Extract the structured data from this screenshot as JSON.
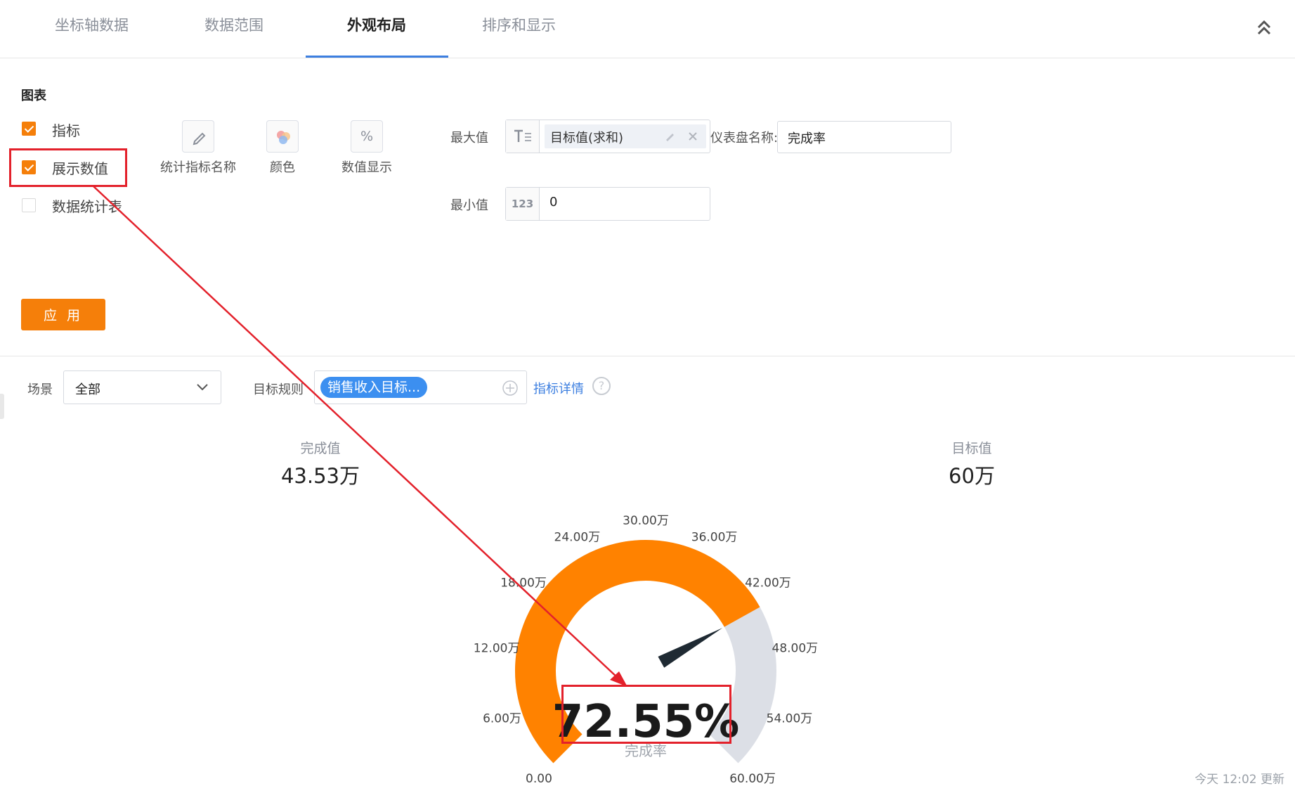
{
  "tabs": [
    {
      "label": "坐标轴数据"
    },
    {
      "label": "数据范围"
    },
    {
      "label": "外观布局"
    },
    {
      "label": "排序和显示"
    }
  ],
  "section_title": "图表",
  "checkboxes": [
    {
      "label": "指标",
      "checked": true
    },
    {
      "label": "展示数值",
      "checked": true
    },
    {
      "label": "数据统计表",
      "checked": false
    }
  ],
  "style_buttons": [
    {
      "label": "统计指标名称",
      "icon": "pencil-icon"
    },
    {
      "label": "颜色",
      "icon": "color-icon"
    },
    {
      "label": "数值显示",
      "icon": "percent-icon",
      "glyph": "%"
    }
  ],
  "max_value": {
    "label": "最大值",
    "prefix_icon": "text-icon",
    "chip": "目标值(求和)"
  },
  "min_value": {
    "label": "最小值",
    "prefix": "123",
    "value": "0"
  },
  "gauge_name": {
    "label": "仪表盘名称:",
    "value": "完成率"
  },
  "apply_label": "应 用",
  "filters": {
    "scene_label": "场景",
    "scene_value": "全部",
    "rule_label": "目标规则",
    "rule_tag": "销售收入目标...",
    "detail_link": "指标详情",
    "help": "?"
  },
  "stats": {
    "completed_label": "完成值",
    "completed_value": "43.53万",
    "target_label": "目标值",
    "target_value": "60万"
  },
  "chart_data": {
    "type": "gauge",
    "min": 0,
    "max": 60,
    "value": 43.53,
    "percent_text": "72.55%",
    "name": "完成率",
    "ticks": [
      "0.00",
      "6.00万",
      "12.00万",
      "18.00万",
      "24.00万",
      "30.00万",
      "36.00万",
      "42.00万",
      "48.00万",
      "54.00万",
      "60.00万"
    ],
    "colors": {
      "fill": "#ff8200",
      "track": "#dcdfe6",
      "needle": "#1f2a33"
    }
  },
  "footer": "今天 12:02 更新",
  "colors": {
    "accent": "#f57f0a",
    "link": "#3d7fe0",
    "annotation": "#e3212b"
  }
}
